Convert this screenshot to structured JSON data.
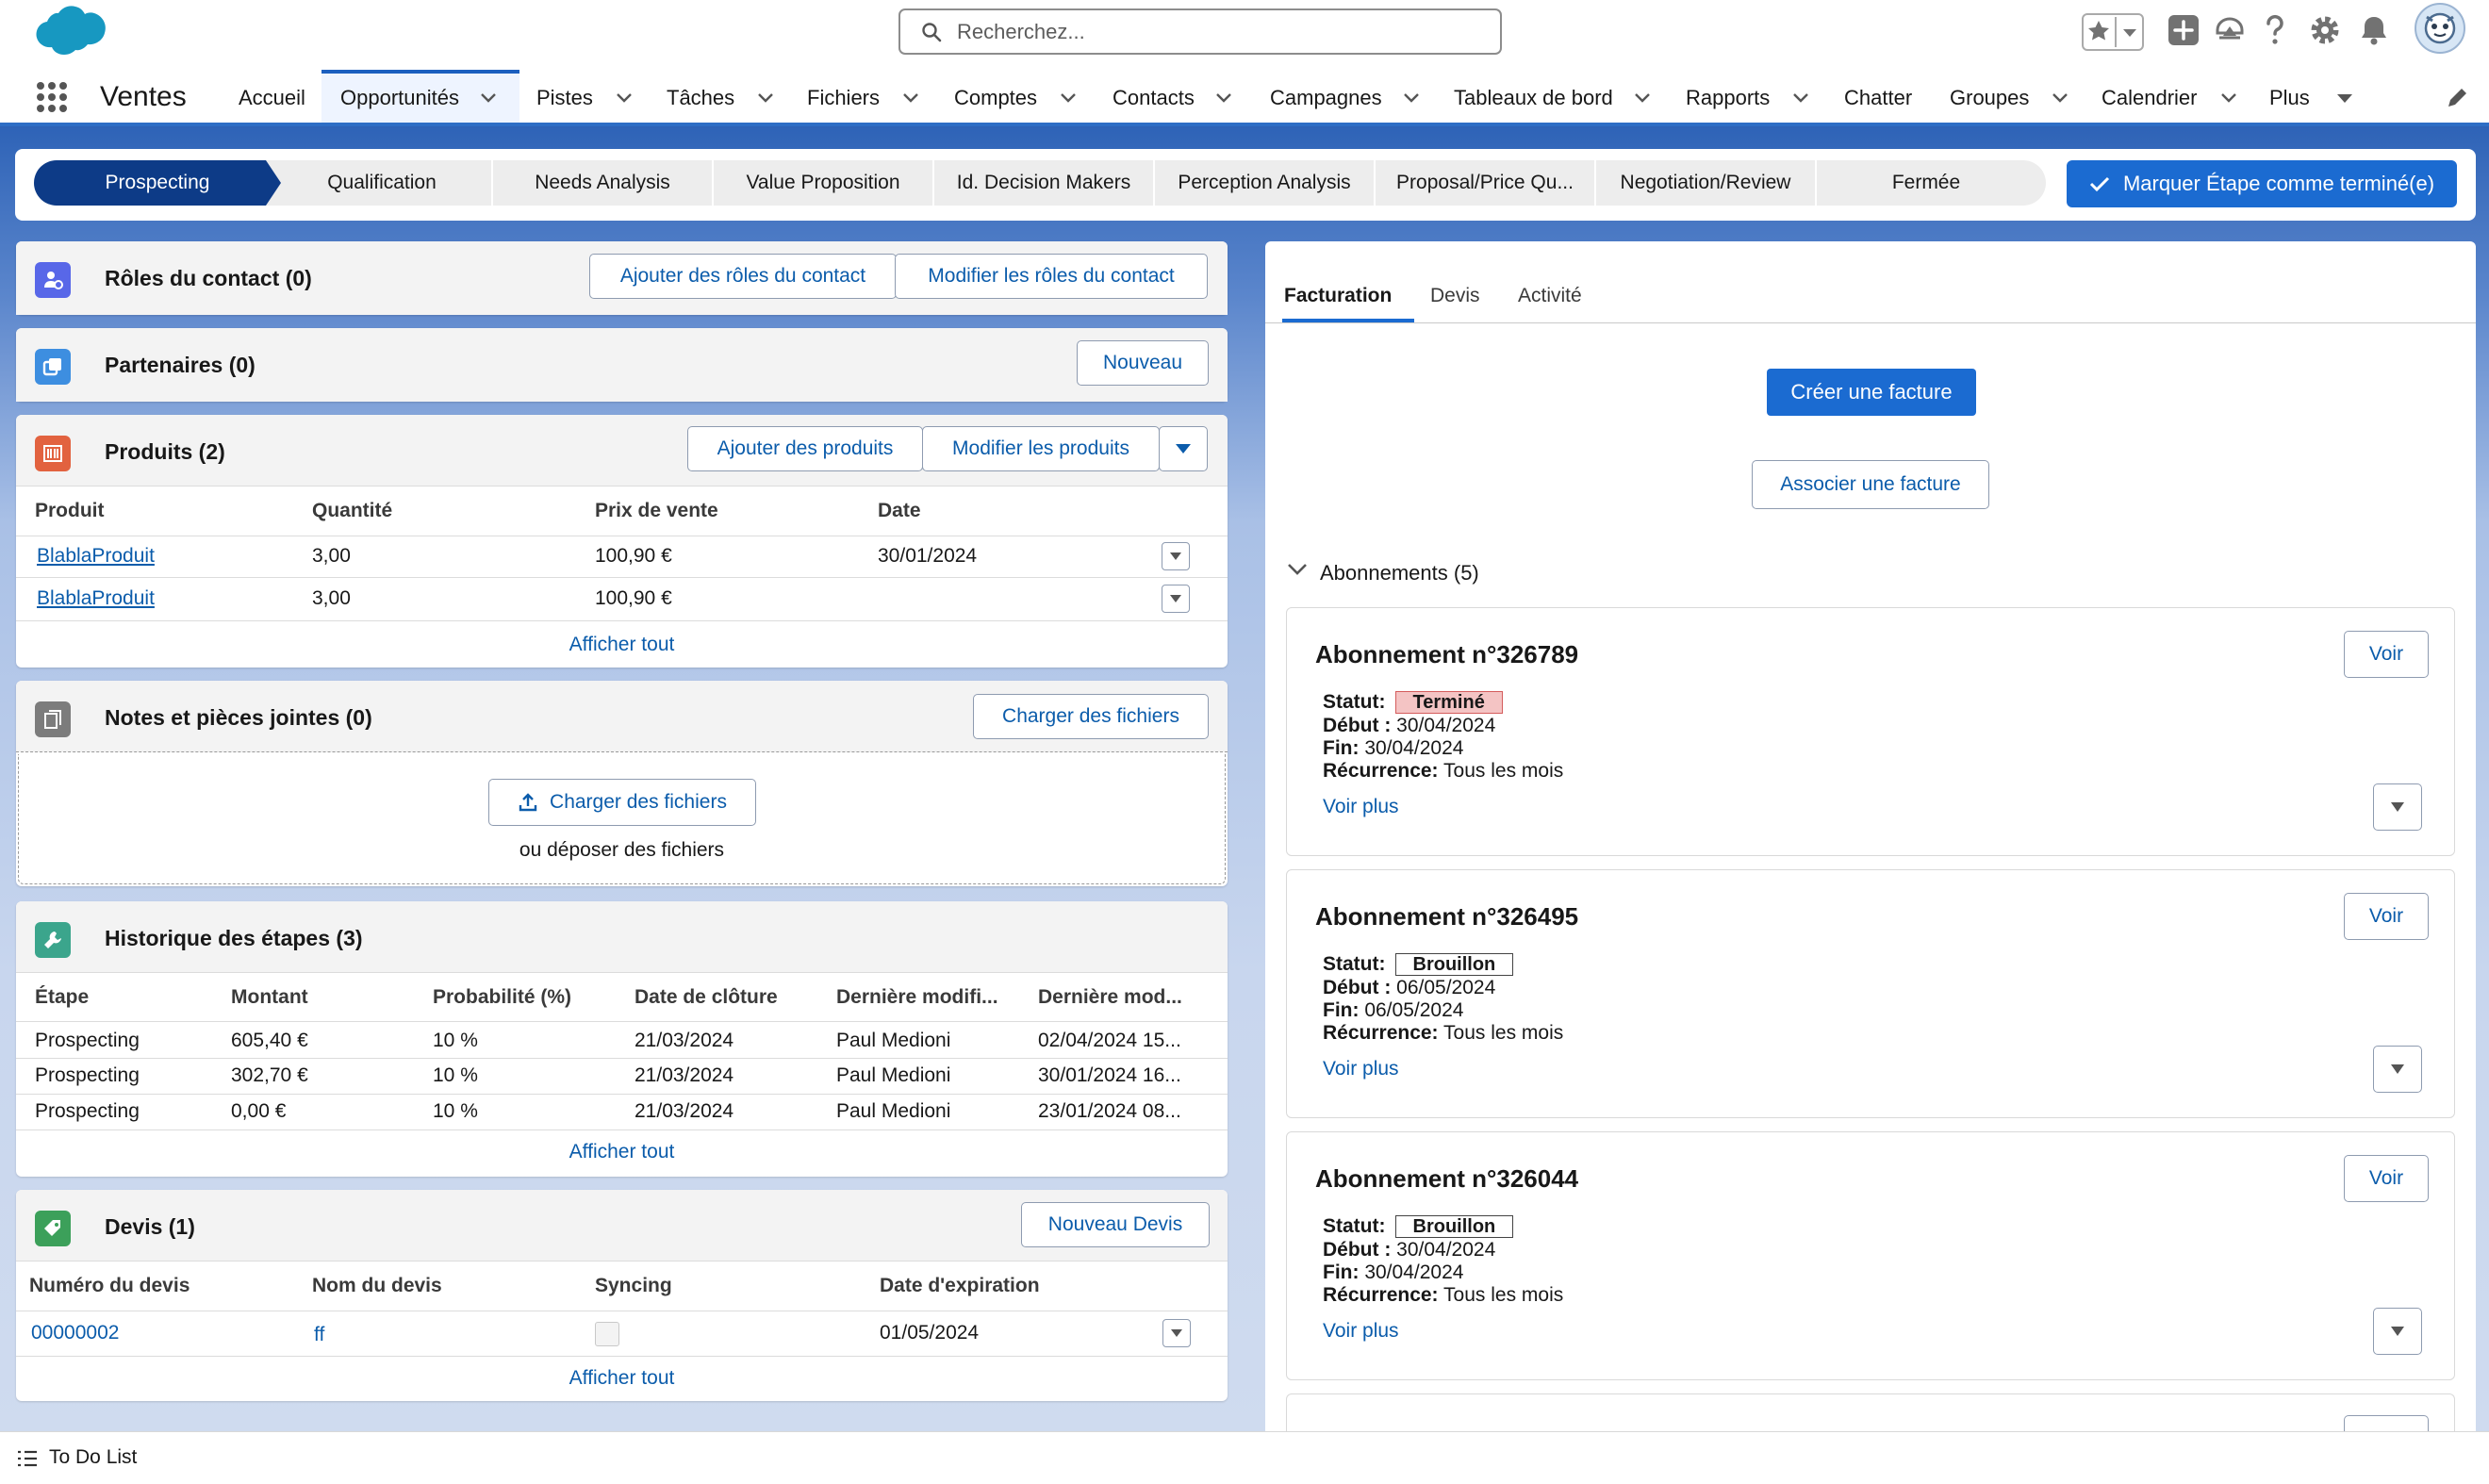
{
  "header": {
    "search_placeholder": "Recherchez..."
  },
  "nav": {
    "app_name": "Ventes",
    "items": [
      {
        "label": "Accueil"
      },
      {
        "label": "Opportunités"
      },
      {
        "label": "Pistes"
      },
      {
        "label": "Tâches"
      },
      {
        "label": "Fichiers"
      },
      {
        "label": "Comptes"
      },
      {
        "label": "Contacts"
      },
      {
        "label": "Campagnes"
      },
      {
        "label": "Tableaux de bord"
      },
      {
        "label": "Rapports"
      },
      {
        "label": "Chatter"
      },
      {
        "label": "Groupes"
      },
      {
        "label": "Calendrier"
      },
      {
        "label": "Plus"
      }
    ]
  },
  "path": {
    "stages": [
      "Prospecting",
      "Qualification",
      "Needs Analysis",
      "Value Proposition",
      "Id. Decision Makers",
      "Perception Analysis",
      "Proposal/Price Qu...",
      "Negotiation/Review",
      "Fermée"
    ],
    "mark_button": "Marquer Étape comme terminé(e)"
  },
  "contact_roles": {
    "title": "Rôles du contact (0)",
    "add_button": "Ajouter des rôles du contact",
    "edit_button": "Modifier les rôles du contact"
  },
  "partners": {
    "title": "Partenaires (0)",
    "new_button": "Nouveau"
  },
  "products": {
    "title": "Produits (2)",
    "add_button": "Ajouter des produits",
    "edit_button": "Modifier les produits",
    "columns": [
      "Produit",
      "Quantité",
      "Prix de vente",
      "Date"
    ],
    "rows": [
      {
        "name": "BlablaProduit",
        "qty": "3,00",
        "price": "100,90 €",
        "date": "30/01/2024"
      },
      {
        "name": "BlablaProduit",
        "qty": "3,00",
        "price": "100,90 €",
        "date": ""
      }
    ],
    "show_all": "Afficher tout"
  },
  "notes": {
    "title": "Notes et pièces jointes (0)",
    "upload_button": "Charger des fichiers",
    "drop_upload_button": "Charger des fichiers",
    "drop_text": "ou déposer des fichiers"
  },
  "stage_history": {
    "title": "Historique des étapes (3)",
    "columns": [
      "Étape",
      "Montant",
      "Probabilité (%)",
      "Date de clôture",
      "Dernière modifi...",
      "Dernière mod..."
    ],
    "rows": [
      {
        "stage": "Prospecting",
        "amount": "605,40 €",
        "prob": "10 %",
        "close": "21/03/2024",
        "by": "Paul Medioni",
        "at": "02/04/2024 15..."
      },
      {
        "stage": "Prospecting",
        "amount": "302,70 €",
        "prob": "10 %",
        "close": "21/03/2024",
        "by": "Paul Medioni",
        "at": "30/01/2024 16..."
      },
      {
        "stage": "Prospecting",
        "amount": "0,00 €",
        "prob": "10 %",
        "close": "21/03/2024",
        "by": "Paul Medioni",
        "at": "23/01/2024 08..."
      }
    ],
    "show_all": "Afficher tout"
  },
  "quotes": {
    "title": "Devis (1)",
    "new_button": "Nouveau Devis",
    "columns": [
      "Numéro du devis",
      "Nom du devis",
      "Syncing",
      "Date d'expiration"
    ],
    "rows": [
      {
        "number": "00000002",
        "name": "ff",
        "syncing": false,
        "expires": "01/05/2024"
      }
    ],
    "show_all": "Afficher tout"
  },
  "right": {
    "tabs": [
      "Facturation",
      "Devis",
      "Activité"
    ],
    "create_invoice": "Créer une facture",
    "link_invoice": "Associer une facture",
    "subscriptions_header": "Abonnements (5)",
    "labels": {
      "status": "Statut:",
      "start": "Début :",
      "end": "Fin:",
      "recurrence": "Récurrence:"
    },
    "view_button": "Voir",
    "more_link": "Voir plus",
    "subscriptions": [
      {
        "title": "Abonnement n°326789",
        "status": "Terminé",
        "status_color": "#f4c4c4",
        "start": "30/04/2024",
        "end": "30/04/2024",
        "recurrence": "Tous les mois"
      },
      {
        "title": "Abonnement n°326495",
        "status": "Brouillon",
        "status_color": "#ffffff",
        "start": "06/05/2024",
        "end": "06/05/2024",
        "recurrence": "Tous les mois"
      },
      {
        "title": "Abonnement n°326044",
        "status": "Brouillon",
        "status_color": "#ffffff",
        "start": "30/04/2024",
        "end": "30/04/2024",
        "recurrence": "Tous les mois"
      }
    ]
  },
  "footer": {
    "todo": "To Do List"
  },
  "colors": {
    "brand": "#1b6bd1",
    "path_active": "#0d3b87",
    "link": "#0b5cab"
  }
}
